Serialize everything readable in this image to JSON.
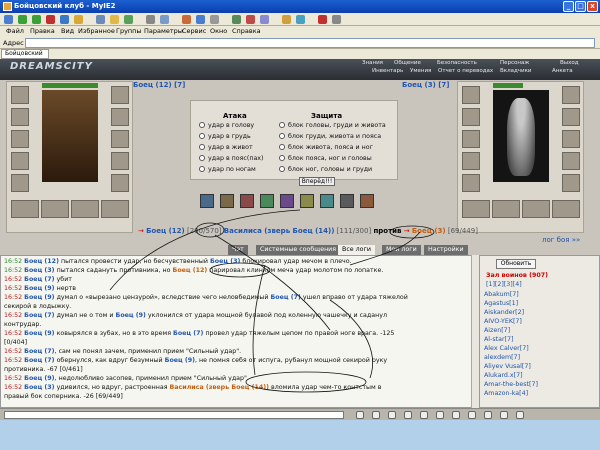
{
  "window": {
    "title": "Бойцовский клуб - MyIE2",
    "min": "_",
    "max": "□",
    "close": "x"
  },
  "menu": [
    "Файл",
    "Правка",
    "Вид",
    "Избранное",
    "Группы",
    "Параметры",
    "Сервис",
    "Окно",
    "Справка"
  ],
  "address_label": "Адрес",
  "browser_tab": "Бойцовский",
  "header": {
    "logo": "DREAMSCITY",
    "nav_top": [
      "Знания",
      "Общение",
      "Безопасность",
      "Персонаж",
      "Выход"
    ],
    "nav_bottom": [
      "Инвентарь",
      "Умения",
      "Отчет о переводах",
      "Вкладчики",
      "Анкета"
    ]
  },
  "fighters": {
    "left_name": "Боец (12) [7]",
    "right_name": "Боец (3) [7]"
  },
  "attack": {
    "title": "Атака",
    "options": [
      "удар в голову",
      "удар в грудь",
      "удар в живот",
      "удар в пояс(пах)",
      "удар по ногам"
    ]
  },
  "defense": {
    "title": "Защита",
    "options": [
      "блок головы, груди и живота",
      "блок груди, живота и пояса",
      "блок живота, пояса и ног",
      "блок пояса, ног и головы",
      "блок ног, головы и груди"
    ]
  },
  "forward_button": "Вперёд!!!",
  "vs": {
    "left": "Боец (12)",
    "left_hp": "[200/570]",
    "mid": "Василиса (зверь Боец (14))",
    "mid_hp": "[111/300]",
    "word": "против",
    "right": "Боец (3)",
    "right_hp": "[69/449]"
  },
  "log_link": "лог боя »»",
  "chat_tabs": [
    "Чат",
    "Системные сообщения",
    "Все логи",
    "Мои логи",
    "Настройки"
  ],
  "chat_lines": [
    {
      "time": "16:52",
      "a": "Боец (12)",
      "text": " пытался провести удар, но бесчувственный ",
      "b": "Боец (3)",
      "rest": " блокировал удар мечом в плечо."
    },
    {
      "time": "16:52",
      "a": "Боец (3)",
      "text": " пытался садануть противника, но ",
      "b": "Боец (12)",
      "rest": " парировал клинком меча удар молотом по лопатке."
    },
    {
      "time": "16:52",
      "a": "Боец (7)",
      "text": " убит",
      "b": "",
      "rest": ""
    },
    {
      "time": "16:52",
      "a": "Боец (9)",
      "text": " нертв",
      "b": "",
      "rest": ""
    },
    {
      "time": "16:52",
      "a": "Боец (9)",
      "text": " думал о «вырезано цензурой», вследствие чего неловбедимый ",
      "b": "Боец (7)",
      "rest": " ушел вправо от удара тяжелой"
    },
    {
      "time": "",
      "a": "",
      "text": "секирой в лодыжку.",
      "b": "",
      "rest": ""
    },
    {
      "time": "16:52",
      "a": "Боец (7)",
      "text": " думал не о том и ",
      "b": "Боец (9)",
      "rest": " уклонился от удара мощной булавой под коленную чашечку и саданул"
    },
    {
      "time": "",
      "a": "",
      "text": "контрудар.",
      "b": "",
      "rest": ""
    },
    {
      "time": "16:52",
      "a": "Боец (9)",
      "text": " ковырялся в зубах, но в это время ",
      "b": "Боец (7)",
      "rest": " провел удар тяжелым цепом по правой ноге врага. -125"
    },
    {
      "time": "",
      "a": "",
      "text": "[0/404]",
      "b": "",
      "rest": ""
    },
    {
      "time": "16:52",
      "a": "Боец (7)",
      "text": ", сам не понял зачем, применил прием \"Сильный удар\".",
      "b": "",
      "rest": ""
    },
    {
      "time": "16:52",
      "a": "Боец (7)",
      "text": " обернулся, как вдруг безумный ",
      "b": "Боец (9)",
      "rest": ", не помня себя от испуга, рубанул мощной секирой руку"
    },
    {
      "time": "",
      "a": "",
      "text": "противника. -67 [0/461]",
      "b": "",
      "rest": ""
    },
    {
      "time": "16:52",
      "a": "Боец (9)",
      "text": ", недолюбливо засопев, применил прием \"Сильный удар\".",
      "b": "",
      "rest": ""
    },
    {
      "time": "16:52",
      "a": "Боец (3)",
      "text": " удивился, но вдруг, растроенная ",
      "b": "Василиса (зверь Боец (14))",
      "rest": " вломила удар чем-то контстым в"
    },
    {
      "time": "",
      "a": "",
      "text": "правый бок соперника. -26 [69/449]",
      "b": "",
      "rest": ""
    }
  ],
  "right_panel": {
    "refresh": "Обновить",
    "room": "Зал воинов (907)",
    "pages": "[1][2][3][4]",
    "players": [
      "Abakum[7]",
      "Agastus[1]",
      "Aiskander[2]",
      "AIVO-YEK[7]",
      "Aizen[7]",
      "Al-star[7]",
      "Alex Calver[7]",
      "alexdem[7]",
      "Aliyev Vusal[7]",
      "Alukard.x[7]",
      "Amar-the-best[7]",
      "Amazon-ka[4]"
    ]
  },
  "colors": {
    "accent": "#2255aa",
    "time_red": "#b01e1e",
    "highlight_orange": "#c25e10"
  }
}
